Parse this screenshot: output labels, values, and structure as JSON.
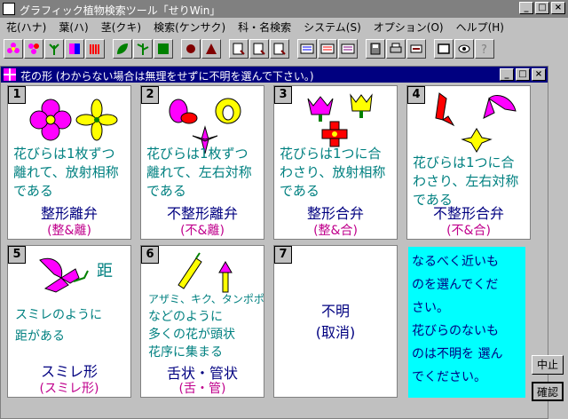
{
  "window": {
    "title": "グラフィック植物検索ツール「せりWin」"
  },
  "menu": [
    "花(ハナ)",
    "葉(ハ)",
    "茎(クキ)",
    "検索(ケンサク)",
    "科・名検索",
    "システム(S)",
    "オプション(O)",
    "ヘルプ(H)"
  ],
  "dialog": {
    "title": "花の形 (わからない場合は無理をせずに不明を選んで下さい。)"
  },
  "cards": [
    {
      "num": "1",
      "desc": [
        "花びらは1枚ずつ",
        "離れて、放射相称",
        "である"
      ],
      "name": "整形離弁",
      "abbr": "(整&離)"
    },
    {
      "num": "2",
      "desc": [
        "花びらは1枚ずつ",
        "離れて、左右対称",
        "である"
      ],
      "name": "不整形離弁",
      "abbr": "(不&離)"
    },
    {
      "num": "3",
      "desc": [
        "花びらは1つに合",
        "わさり、放射相称",
        "である"
      ],
      "name": "整形合弁",
      "abbr": "(整&合)"
    },
    {
      "num": "4",
      "desc": [
        "花びらは1つに合",
        "わさり、左右対称",
        "である"
      ],
      "name": "不整形合弁",
      "abbr": "(不&合)"
    },
    {
      "num": "5",
      "desc": [
        "スミレのように",
        "距がある"
      ],
      "name": "スミレ形",
      "abbr": "(スミレ形)"
    },
    {
      "num": "6",
      "desc": [
        "アザミ、キク、タンポポ",
        "などのように",
        "多くの花が頭状",
        "花序に集まる"
      ],
      "name": "舌状・管状",
      "abbr": "(舌・管)"
    },
    {
      "num": "7",
      "desc": [],
      "name": "不明",
      "abbr": "(取消)"
    }
  ],
  "spur_label": "距",
  "info": [
    "なるべく近いも",
    "のを選んでくだ",
    "さい。",
    "花びらのないも",
    "のは不明を 選ん",
    "でください。"
  ],
  "buttons": {
    "stop": "中止",
    "confirm": "確認"
  },
  "colors": {
    "petal": "#ff00ff",
    "yellow": "#ffff00",
    "red": "#ff0000",
    "green": "#008000",
    "teal": "#008080",
    "navy": "#000080",
    "info_bg": "#00ffff"
  }
}
